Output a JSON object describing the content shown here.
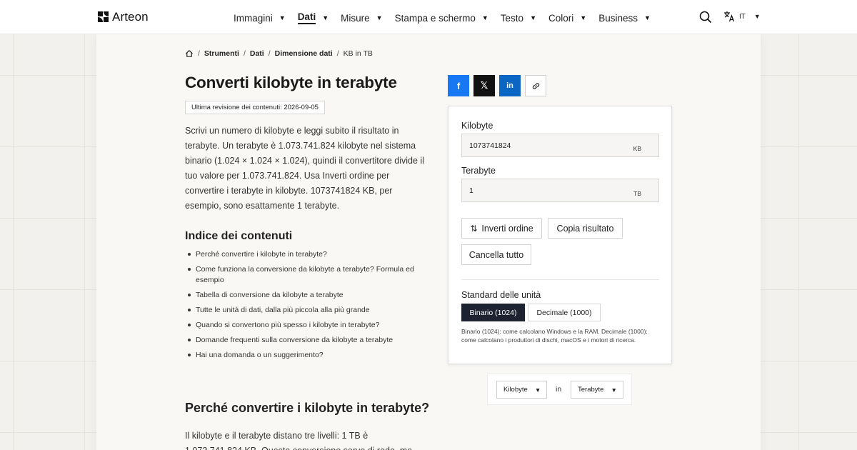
{
  "header": {
    "brand": "Arteon",
    "nav": [
      {
        "label": "Immagini",
        "active": false
      },
      {
        "label": "Dati",
        "active": true
      },
      {
        "label": "Misure",
        "active": false
      },
      {
        "label": "Stampa e schermo",
        "active": false
      },
      {
        "label": "Testo",
        "active": false
      },
      {
        "label": "Colori",
        "active": false
      },
      {
        "label": "Business",
        "active": false
      }
    ],
    "language": "IT"
  },
  "breadcrumb": {
    "items": [
      "Strumenti",
      "Dati",
      "Dimensione dati"
    ],
    "current": "KB in TB"
  },
  "page": {
    "title": "Converti kilobyte in terabyte",
    "revision": "Ultima revisione dei contenuti: 2026-09-05",
    "intro": "Scrivi un numero di kilobyte e leggi subito il risultato in terabyte. Un terabyte è 1.073.741.824 kilobyte nel sistema binario (1.024 × 1.024 × 1.024), quindi il convertitore divide il tuo valore per 1.073.741.824. Usa Inverti ordine per convertire i terabyte in kilobyte. 1073741824 KB, per esempio, sono esattamente 1 terabyte.",
    "toc_title": "Indice dei contenuti",
    "toc": [
      "Perché convertire i kilobyte in terabyte?",
      "Come funziona la conversione da kilobyte a terabyte? Formula ed esempio",
      "Tabella di conversione da kilobyte a terabyte",
      "Tutte le unità di dati, dalla più piccola alla più grande",
      "Quando si convertono più spesso i kilobyte in terabyte?",
      "Domande frequenti sulla conversione da kilobyte a terabyte",
      "Hai una domanda o un suggerimento?"
    ],
    "section_title": "Perché convertire i kilobyte in terabyte?",
    "section_text": "Il kilobyte e il terabyte distano tre livelli: 1 TB è 1.073.741.824 KB. Questa conversione serve di rado, ma"
  },
  "share": {
    "facebook": "f",
    "x": "𝕏",
    "linkedin": "in",
    "link_icon": "link-icon"
  },
  "converter": {
    "from_label": "Kilobyte",
    "from_value": "1073741824",
    "from_unit": "KB",
    "to_label": "Terabyte",
    "to_value": "1",
    "to_unit": "TB",
    "swap_label": "Inverti ordine",
    "copy_label": "Copia risultato",
    "clear_label": "Cancella tutto",
    "standard_label": "Standard delle unità",
    "binary_label": "Binario (1024)",
    "decimal_label": "Decimale (1000)",
    "selected_standard": "binary",
    "note": "Binario (1024): come calcolano Windows e la RAM. Decimale (1000): come calcolano i produttori di dischi, macOS e i motori di ricerca."
  },
  "unit_selector": {
    "from": "Kilobyte",
    "in": "in",
    "to": "Terabyte"
  },
  "colors": {
    "accent_dark": "#1d2230",
    "facebook": "#1877f2",
    "linkedin": "#0a66c2"
  }
}
